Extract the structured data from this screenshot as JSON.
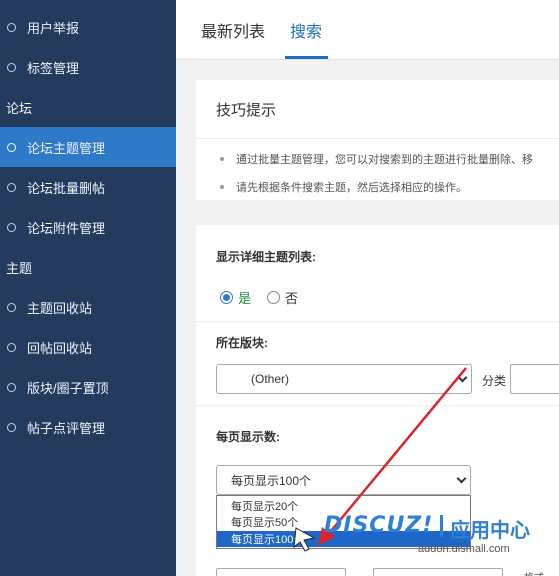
{
  "sidebar": {
    "items_top": [
      "用户举报",
      "标签管理"
    ],
    "group_forum": "论坛",
    "items_forum": [
      "论坛主题管理",
      "论坛批量删帖",
      "论坛附件管理"
    ],
    "group_thread": "主题",
    "items_thread": [
      "主题回收站",
      "回帖回收站",
      "版块/圈子置顶",
      "帖子点评管理"
    ],
    "active_item": "论坛主题管理"
  },
  "tabs": [
    "最新列表",
    "搜索"
  ],
  "active_tab": "搜索",
  "tips": {
    "title": "技巧提示",
    "lines": [
      "通过批量主题管理，您可以对搜索到的主题进行批量删除、移",
      "请先根据条件搜索主题，然后选择相应的操作。"
    ]
  },
  "form": {
    "show_detail_label": "显示详细主题列表:",
    "radio_yes": "是",
    "radio_no": "否",
    "radio_selected": "是",
    "forum_label": "所在版块:",
    "forum_select_value": "(Other)",
    "category_label": "分类",
    "per_page_label": "每页显示数:",
    "per_page_value": "每页显示100个",
    "per_page_options": [
      "每页显示20个",
      "每页显示50个",
      "每页显示100个"
    ],
    "per_page_highlighted": "每页显示100个"
  },
  "watermark": {
    "logo": "DISCUZ!",
    "cn": "应用中心",
    "url": "addon.dismall.com"
  },
  "bottom_fragment": "格式",
  "colors": {
    "sidebar_bg": "#243b5e",
    "sidebar_active": "#2f79c9",
    "accent": "#1f6fbf",
    "arrow": "#d9262c",
    "dropdown_selected": "#1e66c8"
  }
}
